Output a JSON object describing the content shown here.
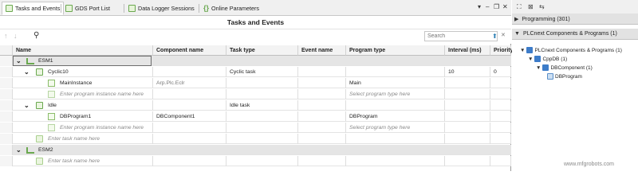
{
  "tabs": [
    {
      "label": "Tasks and Events",
      "icon": "tasks-icon",
      "active": true
    },
    {
      "label": "GDS Port List",
      "icon": "list-icon",
      "active": false
    },
    {
      "label": "Data Logger Sessions",
      "icon": "data-logger-icon",
      "active": false
    },
    {
      "label": "Online Parameters",
      "icon": "braces-icon",
      "active": false
    }
  ],
  "window_controls": {
    "dropdown": "▾",
    "minimize": "–",
    "restore": "❐",
    "close": "✕"
  },
  "title": "Tasks and Events",
  "toolbar": {
    "up_icon": "↑",
    "down_icon": "↓",
    "search_icon": "⚲"
  },
  "search": {
    "placeholder": "Search",
    "value": ""
  },
  "columns": [
    "Name",
    "Component name",
    "Task type",
    "Event name",
    "Program type",
    "Interval (ms)",
    "Priority"
  ],
  "rows": {
    "esm1": {
      "name": "ESM1"
    },
    "cyclic10": {
      "name": "Cyclic10",
      "task_type": "Cyclic task",
      "interval": "10",
      "priority": "0"
    },
    "main": {
      "name": "MainInstance",
      "component": "Arp.Plc.Eclr",
      "program_type": "Main"
    },
    "ph1": {
      "name": "Enter program instance name here",
      "program_type": "Select program type here"
    },
    "idle": {
      "name": "Idle",
      "task_type": "Idle task"
    },
    "dbprog": {
      "name": "DBProgram1",
      "component": "DBComponent1",
      "program_type": "DBProgram"
    },
    "ph2": {
      "name": "Enter program instance name here",
      "program_type": "Select program type here"
    },
    "task_ph1": {
      "name": "Enter task name here"
    },
    "esm2": {
      "name": "ESM2"
    },
    "task_ph2": {
      "name": "Enter task name here"
    }
  },
  "right_panel": {
    "toolbar_icons": [
      "expand-all-icon",
      "collapse-all-icon",
      "sort-icon"
    ],
    "sections": [
      {
        "label": "Programming (301)",
        "expanded": false
      },
      {
        "label": "PLCnext Components & Programs (1)",
        "expanded": true
      }
    ],
    "tree": [
      {
        "label": "PLCnext Components & Programs (1)"
      },
      {
        "label": "CppDB (1)"
      },
      {
        "label": "DBComponent (1)"
      },
      {
        "label": "DBProgram"
      }
    ]
  },
  "watermark": "www.mfgrobots.com"
}
